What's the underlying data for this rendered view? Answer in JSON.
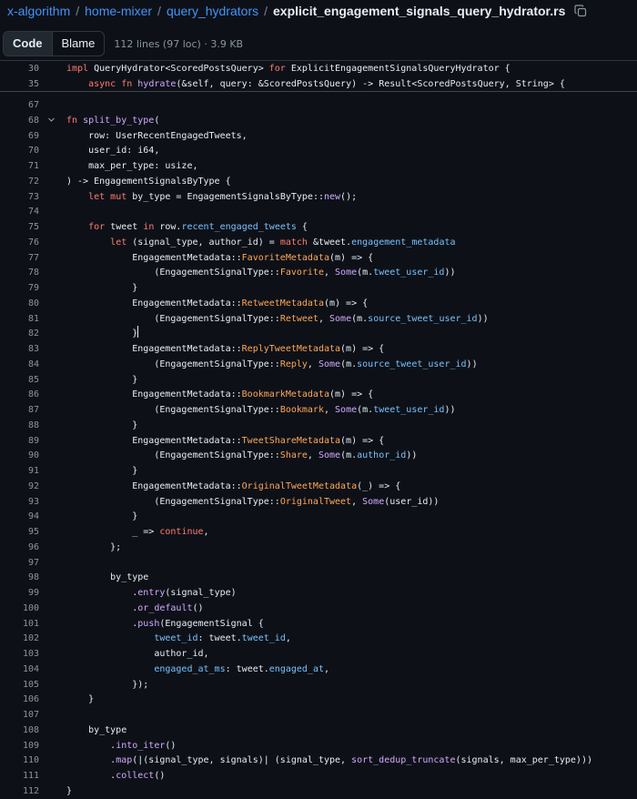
{
  "breadcrumb": {
    "items": [
      "x-algorithm",
      "home-mixer",
      "query_hydrators"
    ],
    "file": "explicit_engagement_signals_query_hydrator.rs",
    "separator": "/"
  },
  "toolbar": {
    "code_label": "Code",
    "blame_label": "Blame",
    "file_meta": "112 lines (97 loc) · 3.9 KB"
  },
  "sticky_lines": [
    {
      "n": "30",
      "t": [
        [
          "k",
          "impl "
        ],
        [
          "",
          "QueryHydrator<ScoredPostsQuery> "
        ],
        [
          "k",
          "for "
        ],
        [
          "",
          "ExplicitEngagementSignalsQueryHydrator {"
        ]
      ]
    },
    {
      "n": "35",
      "t": [
        [
          "",
          "    "
        ],
        [
          "k",
          "async fn "
        ],
        [
          "f",
          "hydrate"
        ],
        [
          "",
          "(&self, query: &ScoredPostsQuery) -> Result<ScoredPostsQuery, String> {"
        ]
      ]
    }
  ],
  "code_lines": [
    {
      "n": "67",
      "t": []
    },
    {
      "n": "68",
      "fold": true,
      "t": [
        [
          "k",
          "fn "
        ],
        [
          "f",
          "split_by_type"
        ],
        [
          "",
          "("
        ]
      ]
    },
    {
      "n": "69",
      "t": [
        [
          "",
          "    row: UserRecentEngagedTweets,"
        ]
      ]
    },
    {
      "n": "70",
      "t": [
        [
          "",
          "    user_id: i64,"
        ]
      ]
    },
    {
      "n": "71",
      "t": [
        [
          "",
          "    max_per_type: usize,"
        ]
      ]
    },
    {
      "n": "72",
      "t": [
        [
          "",
          ") -> EngagementSignalsByType {"
        ]
      ]
    },
    {
      "n": "73",
      "t": [
        [
          "",
          "    "
        ],
        [
          "k",
          "let mut "
        ],
        [
          "",
          "by_type = EngagementSignalsByType::"
        ],
        [
          "f",
          "new"
        ],
        [
          "",
          "();"
        ]
      ]
    },
    {
      "n": "74",
      "t": []
    },
    {
      "n": "75",
      "t": [
        [
          "",
          "    "
        ],
        [
          "k",
          "for "
        ],
        [
          "",
          "tweet "
        ],
        [
          "k",
          "in "
        ],
        [
          "",
          "row."
        ],
        [
          "c",
          "recent_engaged_tweets"
        ],
        [
          "",
          " {"
        ]
      ]
    },
    {
      "n": "76",
      "t": [
        [
          "",
          "        "
        ],
        [
          "k",
          "let "
        ],
        [
          "",
          "(signal_type, author_id) = "
        ],
        [
          "k",
          "match "
        ],
        [
          "",
          "&tweet."
        ],
        [
          "c",
          "engagement_metadata"
        ],
        [
          "",
          "",
          " {"
        ]
      ]
    },
    {
      "n": "77",
      "t": [
        [
          "",
          "            EngagementMetadata::"
        ],
        [
          "p",
          "FavoriteMetadata"
        ],
        [
          "",
          "(m) => {"
        ]
      ]
    },
    {
      "n": "78",
      "t": [
        [
          "",
          "                (EngagementSignalType::"
        ],
        [
          "p",
          "Favorite"
        ],
        [
          "",
          ", "
        ],
        [
          "f",
          "Some"
        ],
        [
          "",
          "(m."
        ],
        [
          "c",
          "tweet_user_id"
        ],
        [
          "",
          "))"
        ]
      ]
    },
    {
      "n": "79",
      "t": [
        [
          "",
          "            }"
        ]
      ]
    },
    {
      "n": "80",
      "t": [
        [
          "",
          "            EngagementMetadata::"
        ],
        [
          "p",
          "RetweetMetadata"
        ],
        [
          "",
          "(m) => {"
        ]
      ]
    },
    {
      "n": "81",
      "t": [
        [
          "",
          "                (EngagementSignalType::"
        ],
        [
          "p",
          "Retweet"
        ],
        [
          "",
          ", "
        ],
        [
          "f",
          "Some"
        ],
        [
          "",
          "(m."
        ],
        [
          "c",
          "source_tweet_user_id"
        ],
        [
          "",
          "))"
        ]
      ]
    },
    {
      "n": "82",
      "cursor": true,
      "t": [
        [
          "",
          "            }"
        ]
      ]
    },
    {
      "n": "83",
      "t": [
        [
          "",
          "            EngagementMetadata::"
        ],
        [
          "p",
          "ReplyTweetMetadata"
        ],
        [
          "",
          "(m) => {"
        ]
      ]
    },
    {
      "n": "84",
      "t": [
        [
          "",
          "                (EngagementSignalType::"
        ],
        [
          "p",
          "Reply"
        ],
        [
          "",
          ", "
        ],
        [
          "f",
          "Some"
        ],
        [
          "",
          "(m."
        ],
        [
          "c",
          "source_tweet_user_id"
        ],
        [
          "",
          "))"
        ]
      ]
    },
    {
      "n": "85",
      "t": [
        [
          "",
          "            }"
        ]
      ]
    },
    {
      "n": "86",
      "t": [
        [
          "",
          "            EngagementMetadata::"
        ],
        [
          "p",
          "BookmarkMetadata"
        ],
        [
          "",
          "(m) => {"
        ]
      ]
    },
    {
      "n": "87",
      "t": [
        [
          "",
          "                (EngagementSignalType::"
        ],
        [
          "p",
          "Bookmark"
        ],
        [
          "",
          ", "
        ],
        [
          "f",
          "Some"
        ],
        [
          "",
          "(m."
        ],
        [
          "c",
          "tweet_user_id"
        ],
        [
          "",
          "))"
        ]
      ]
    },
    {
      "n": "88",
      "t": [
        [
          "",
          "            }"
        ]
      ]
    },
    {
      "n": "89",
      "t": [
        [
          "",
          "            EngagementMetadata::"
        ],
        [
          "p",
          "TweetShareMetadata"
        ],
        [
          "",
          "(m) => {"
        ]
      ]
    },
    {
      "n": "90",
      "t": [
        [
          "",
          "                (EngagementSignalType::"
        ],
        [
          "p",
          "Share"
        ],
        [
          "",
          ", "
        ],
        [
          "f",
          "Some"
        ],
        [
          "",
          "(m."
        ],
        [
          "c",
          "author_id"
        ],
        [
          "",
          "))"
        ]
      ]
    },
    {
      "n": "91",
      "t": [
        [
          "",
          "            }"
        ]
      ]
    },
    {
      "n": "92",
      "t": [
        [
          "",
          "            EngagementMetadata::"
        ],
        [
          "p",
          "OriginalTweetMetadata"
        ],
        [
          "",
          "(_) => {"
        ]
      ]
    },
    {
      "n": "93",
      "t": [
        [
          "",
          "                (EngagementSignalType::"
        ],
        [
          "p",
          "OriginalTweet"
        ],
        [
          "",
          ", "
        ],
        [
          "f",
          "Some"
        ],
        [
          "",
          "(user_id))"
        ]
      ]
    },
    {
      "n": "94",
      "t": [
        [
          "",
          "            }"
        ]
      ]
    },
    {
      "n": "95",
      "t": [
        [
          "",
          "            _ => "
        ],
        [
          "k",
          "continue"
        ],
        [
          "",
          ","
        ]
      ]
    },
    {
      "n": "96",
      "t": [
        [
          "",
          "        };"
        ]
      ]
    },
    {
      "n": "97",
      "t": []
    },
    {
      "n": "98",
      "t": [
        [
          "",
          "        by_type"
        ]
      ]
    },
    {
      "n": "99",
      "t": [
        [
          "",
          "            ."
        ],
        [
          "f",
          "entry"
        ],
        [
          "",
          "(signal_type)"
        ]
      ]
    },
    {
      "n": "100",
      "t": [
        [
          "",
          "            ."
        ],
        [
          "f",
          "or_default"
        ],
        [
          "",
          "()"
        ]
      ]
    },
    {
      "n": "101",
      "t": [
        [
          "",
          "            ."
        ],
        [
          "f",
          "push"
        ],
        [
          "",
          "(EngagementSignal {"
        ]
      ]
    },
    {
      "n": "102",
      "t": [
        [
          "",
          "                "
        ],
        [
          "c",
          "tweet_id"
        ],
        [
          "",
          ": tweet."
        ],
        [
          "c",
          "tweet_id"
        ],
        [
          "",
          ","
        ]
      ]
    },
    {
      "n": "103",
      "t": [
        [
          "",
          "                author_id,"
        ]
      ]
    },
    {
      "n": "104",
      "t": [
        [
          "",
          "                "
        ],
        [
          "c",
          "engaged_at_ms"
        ],
        [
          "",
          ": tweet."
        ],
        [
          "c",
          "engaged_at"
        ],
        [
          "",
          ","
        ]
      ]
    },
    {
      "n": "105",
      "t": [
        [
          "",
          "            });"
        ]
      ]
    },
    {
      "n": "106",
      "t": [
        [
          "",
          "    }"
        ]
      ]
    },
    {
      "n": "107",
      "t": []
    },
    {
      "n": "108",
      "t": [
        [
          "",
          "    by_type"
        ]
      ]
    },
    {
      "n": "109",
      "t": [
        [
          "",
          "        ."
        ],
        [
          "f",
          "into_iter"
        ],
        [
          "",
          "()"
        ]
      ]
    },
    {
      "n": "110",
      "t": [
        [
          "",
          "        ."
        ],
        [
          "f",
          "map"
        ],
        [
          "",
          "(|(signal_type, signals)| (signal_type, "
        ],
        [
          "f",
          "sort_dedup_truncate"
        ],
        [
          "",
          "(signals, max_per_type)))"
        ]
      ]
    },
    {
      "n": "111",
      "t": [
        [
          "",
          "        ."
        ],
        [
          "f",
          "collect"
        ],
        [
          "",
          "()"
        ]
      ]
    },
    {
      "n": "112",
      "t": [
        [
          "",
          "}"
        ]
      ]
    }
  ],
  "colors": {
    "background": "#0d1117",
    "keyword": "#ff7b72",
    "function": "#d2a8ff",
    "constant": "#79c0ff",
    "variant": "#ffa657",
    "link": "#4493f8"
  }
}
